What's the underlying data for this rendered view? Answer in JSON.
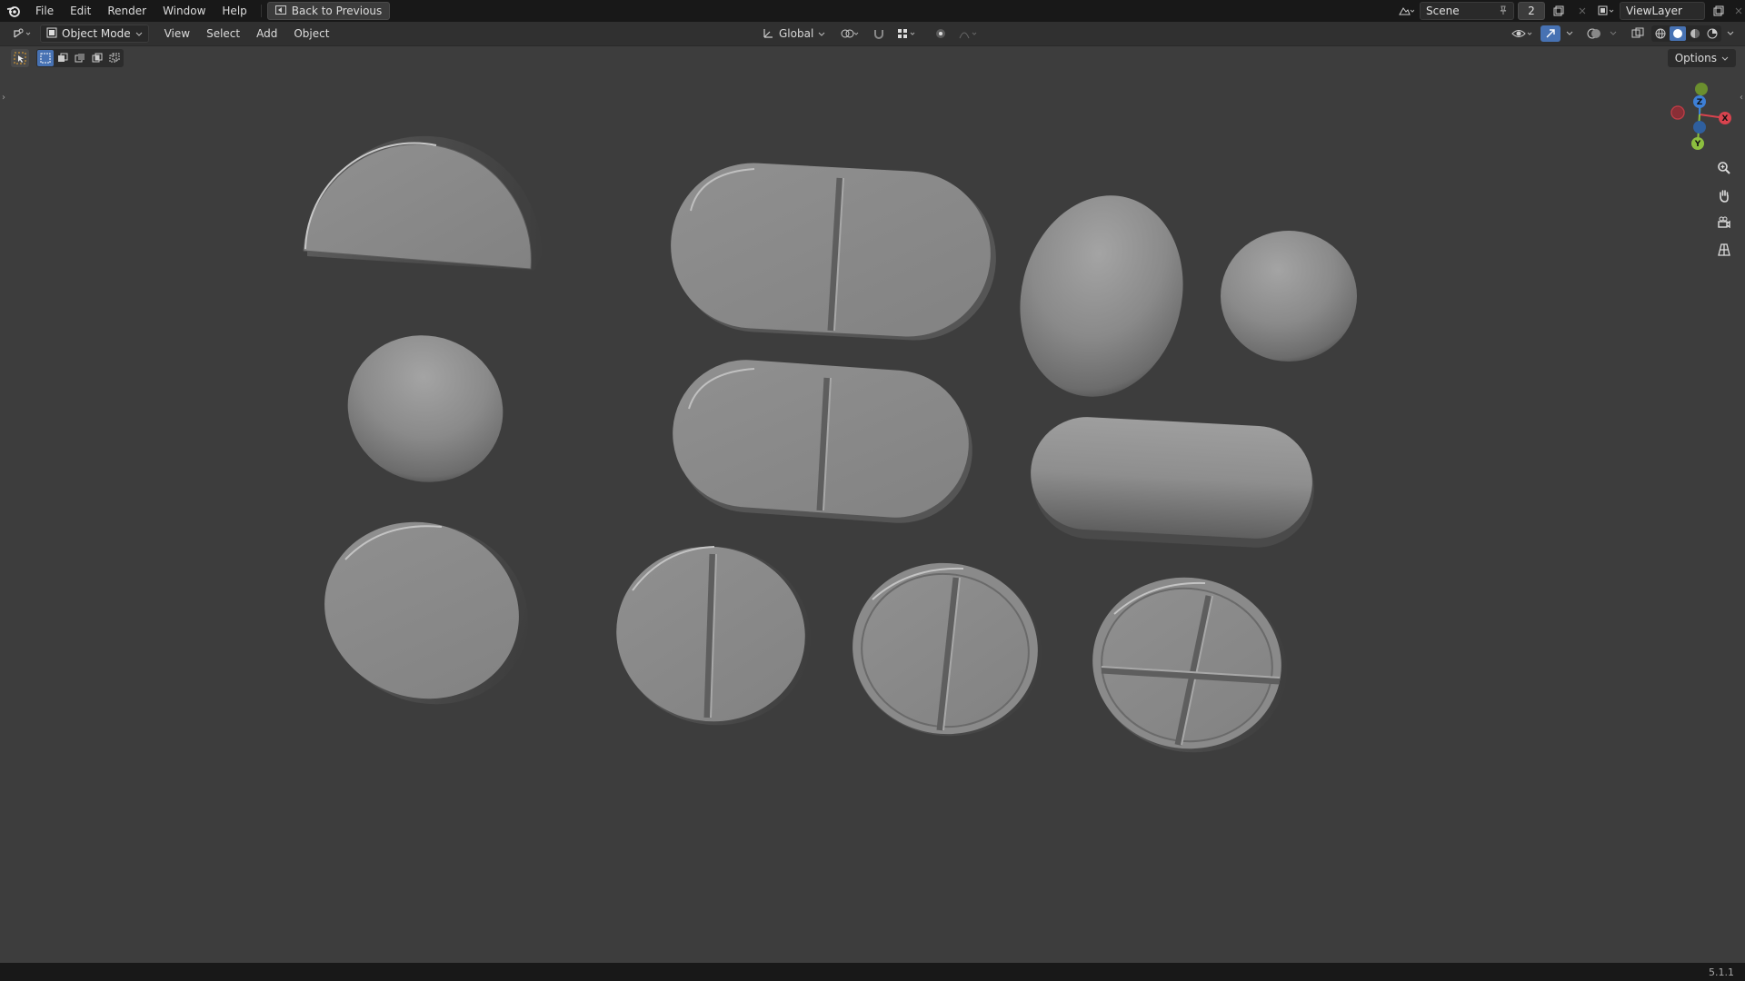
{
  "topbar": {
    "menus": [
      "File",
      "Edit",
      "Render",
      "Window",
      "Help"
    ],
    "back_button": "Back to Previous",
    "scene_name": "Scene",
    "scene_count": "2",
    "view_layer": "ViewLayer"
  },
  "header": {
    "mode": "Object Mode",
    "menus": [
      "View",
      "Select",
      "Add",
      "Object"
    ],
    "transform_orientation": "Global"
  },
  "toolbar": {
    "options_label": "Options"
  },
  "gizmo": {
    "x_label": "X",
    "y_label": "Y",
    "z_label": "Z"
  },
  "status": {
    "version": "5.1.1"
  }
}
